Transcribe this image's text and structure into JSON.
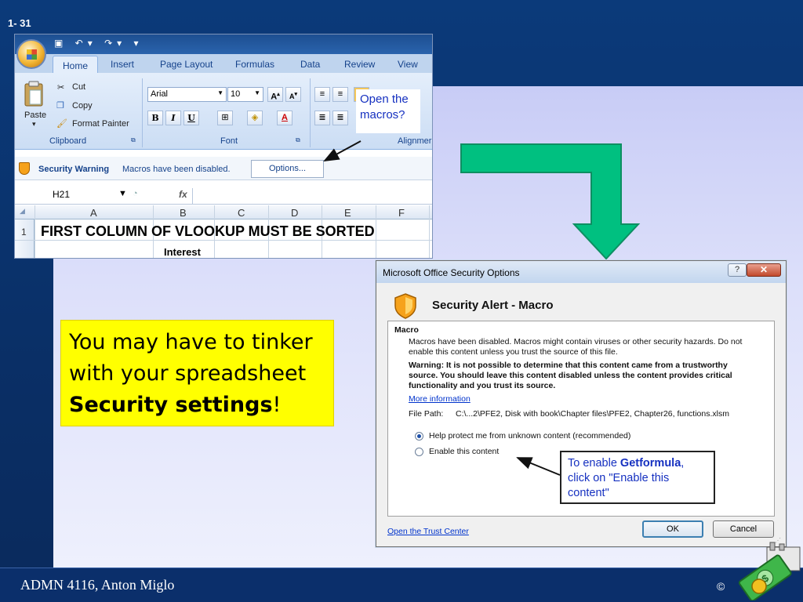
{
  "slide": {
    "number": "1- 31",
    "footer": "ADMN 4116, Anton Miglo",
    "copyright": "©"
  },
  "excel": {
    "qat_icons": "▣ ↶▾ ↷▾ ▾",
    "tabs": [
      "Home",
      "Insert",
      "Page Layout",
      "Formulas",
      "Data",
      "Review",
      "View"
    ],
    "clipboard": {
      "paste": "Paste",
      "cut": "Cut",
      "copy": "Copy",
      "format_painter": "Format Painter",
      "group_label": "Clipboard"
    },
    "font": {
      "name": "Arial",
      "size": "10",
      "group_label": "Font"
    },
    "alignment_label": "Alignmer",
    "callout": "Open the macros?",
    "security_bar": {
      "title": "Security Warning",
      "message": "Macros have been disabled.",
      "options_button": "Options..."
    },
    "formula_bar": {
      "name_box": "H21",
      "fx": "fx"
    },
    "columns": [
      "A",
      "B",
      "C",
      "D",
      "E",
      "F"
    ],
    "rows": [
      "1"
    ],
    "cell_a1": "FIRST COLUMN OF VLOOKUP MUST BE SORTED",
    "cell_b2": "Interest"
  },
  "note": {
    "line1": "You may have to tinker",
    "line2": "with your spreadsheet",
    "bold": "Security settings",
    "suffix": "!"
  },
  "dialog": {
    "title": "Microsoft Office Security Options",
    "help": "?",
    "close": "✕",
    "alert_title": "Security Alert - Macro",
    "section": "Macro",
    "desc": "Macros have been disabled. Macros might contain viruses or other security hazards. Do not enable this content unless you trust the source of this file.",
    "warning": "Warning: It is not possible to determine that this content came from a trustworthy source. You should leave this content disabled unless the content provides critical functionality and you trust its source.",
    "more_info": "More information",
    "file_path_label": "File Path:",
    "file_path": "C:\\...2\\PFE2, Disk with book\\Chapter files\\PFE2, Chapter26, functions.xlsm",
    "option_protect": "Help protect me from unknown content (recommended)",
    "option_enable": "Enable this content",
    "trust_center": "Open the Trust Center",
    "ok": "OK",
    "cancel": "Cancel"
  },
  "dialog_callout": {
    "prefix": "To enable ",
    "bold": "Getformula",
    "suffix": ", click on \"Enable this content\""
  },
  "colors": {
    "arrow_green": "#00c080",
    "note_yellow": "#ffff00",
    "callout_blue": "#1530c0"
  }
}
